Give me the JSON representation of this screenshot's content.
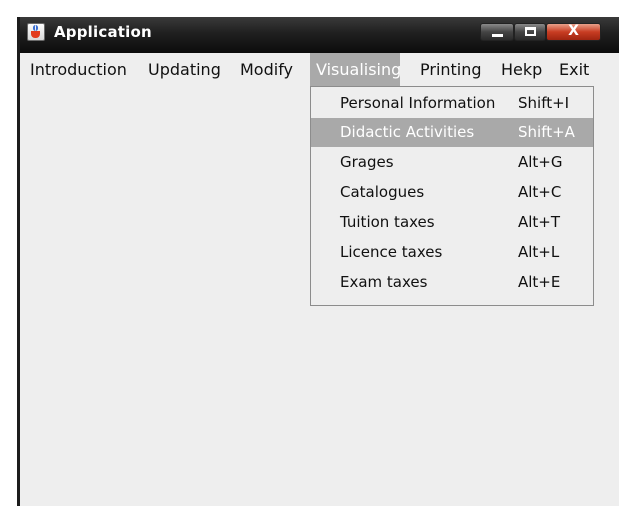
{
  "window": {
    "title": "Application",
    "icon": "java-icon",
    "controls": {
      "minimize": "minimize-icon",
      "maximize": "maximize-icon",
      "close": "X"
    }
  },
  "menubar": {
    "items": [
      {
        "label": "Introduction"
      },
      {
        "label": "Updating"
      },
      {
        "label": "Modify"
      },
      {
        "label": "Visualising",
        "active": true
      },
      {
        "label": "Printing"
      },
      {
        "label": "Hekp"
      },
      {
        "label": "Exit"
      }
    ]
  },
  "dropdown": {
    "items": [
      {
        "label": "Personal Information",
        "accelerator": "Shift+I"
      },
      {
        "label": "Didactic Activities",
        "accelerator": "Shift+A",
        "selected": true
      },
      {
        "label": "Grages",
        "accelerator": "Alt+G"
      },
      {
        "label": "Catalogues",
        "accelerator": "Alt+C"
      },
      {
        "label": "Tuition taxes",
        "accelerator": "Alt+T"
      },
      {
        "label": "Licence taxes",
        "accelerator": "Alt+L"
      },
      {
        "label": "Exam taxes",
        "accelerator": "Alt+E"
      }
    ]
  },
  "colors": {
    "titlebar": "#1f1f1f",
    "window_bg": "#eeeeee",
    "highlight": "#a9a9a9",
    "close_button": "#c83c22"
  }
}
